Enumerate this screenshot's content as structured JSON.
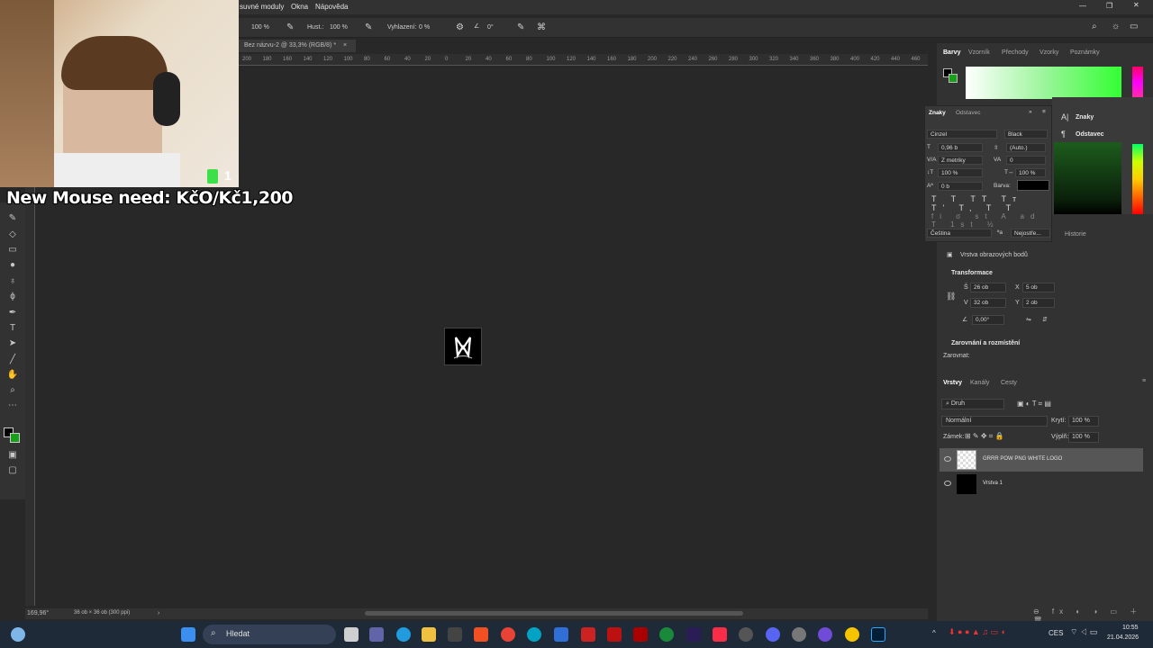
{
  "menubar": {
    "items": [
      "suvné moduly",
      "Okna",
      "Nápověda"
    ]
  },
  "options_bar": {
    "size_value": "100 %",
    "flow_label": "Hust.:",
    "flow_value": "100 %",
    "smoothing_label": "Vyhlazení:",
    "smoothing_value": "0 %",
    "angle_value": "0°"
  },
  "document": {
    "tab_title": "Bez názvu-2 @ 33,3% (RGB/8) *"
  },
  "ruler": {
    "ticks": [
      "200",
      "180",
      "160",
      "140",
      "120",
      "100",
      "80",
      "60",
      "40",
      "20",
      "0",
      "20",
      "40",
      "60",
      "80",
      "100",
      "120",
      "140",
      "160",
      "180",
      "200",
      "220",
      "240",
      "260",
      "280",
      "300",
      "320",
      "340",
      "360",
      "380",
      "400",
      "420",
      "440",
      "460"
    ]
  },
  "status": {
    "zoom": "169,96°",
    "doc_info": "36 ob × 36 ob (300 ppi)"
  },
  "color_panel": {
    "tabs": [
      "Barvy",
      "Vzorník",
      "Přechody",
      "Vzorky",
      "Poznámky"
    ],
    "active_tab": "Barvy"
  },
  "character_panel": {
    "tabs": [
      "Znaky",
      "Odstavec"
    ],
    "font_family": "Cinzel",
    "font_style": "Black",
    "font_size": "0,96 b",
    "leading": "(Auto.)",
    "kerning": "Z metriky",
    "tracking": "0",
    "vertical_scale": "100 %",
    "horizontal_scale": "100 %",
    "baseline_shift": "0 b",
    "color_label": "Barva:",
    "language": "Čeština",
    "antialias": "Nejostře..."
  },
  "flyout": {
    "items": [
      "Znaky",
      "Odstavec"
    ]
  },
  "history_tab": "Historie",
  "properties": {
    "layer_type": "Vrstva obrazových bodů",
    "transform_header": "Transformace",
    "width": "26 ob",
    "height": "32 ob",
    "x": "5 ob",
    "y": "2 ob",
    "angle": "0,00°",
    "w_label": "Š",
    "h_label": "V",
    "x_label": "X",
    "y_label": "Y",
    "align_header": "Zarovnání a rozmístění",
    "align_label": "Zarovnat:"
  },
  "layers_panel": {
    "tabs": [
      "Vrstvy",
      "Kanály",
      "Cesty"
    ],
    "active_tab": "Vrstvy",
    "filter": "Druh",
    "blend_mode": "Normální",
    "opacity_label": "Krytí:",
    "opacity": "100 %",
    "lock_label": "Zámek:",
    "fill_label": "Výplň:",
    "fill": "100 %",
    "layers": [
      {
        "name": "GRRR POW PNG WHITE LOGO",
        "selected": true
      },
      {
        "name": "Vrstva 1",
        "selected": false
      }
    ]
  },
  "webcam": {
    "overlay_text": "New Mouse need: KčO/Kč1,200",
    "badge": "1"
  },
  "taskbar": {
    "search_placeholder": "Hledat",
    "language": "CES",
    "time": "10:55",
    "date": "21.04.2026"
  }
}
